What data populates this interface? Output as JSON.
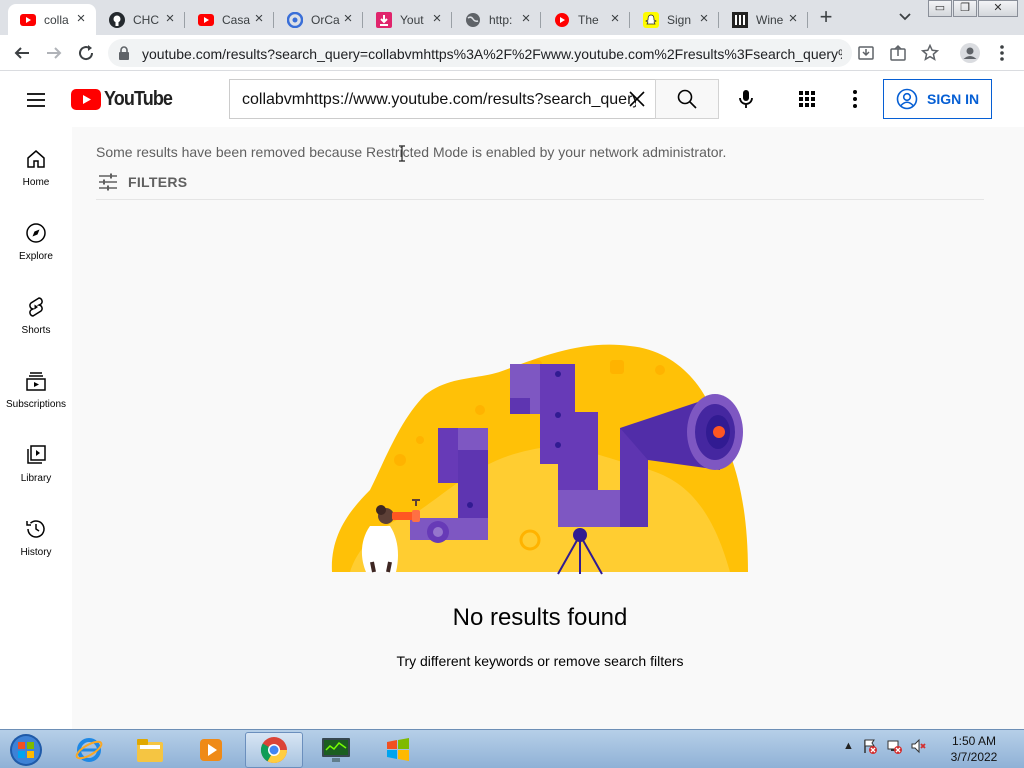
{
  "browser": {
    "tabs": [
      {
        "title": "colla",
        "icon": "youtube-icon",
        "active": true
      },
      {
        "title": "CHC",
        "icon": "github-icon",
        "active": false
      },
      {
        "title": "Casa",
        "icon": "youtube-icon",
        "active": false
      },
      {
        "title": "OrCa",
        "icon": "orca-icon",
        "active": false
      },
      {
        "title": "Yout",
        "icon": "download-icon",
        "active": false
      },
      {
        "title": "http:",
        "icon": "globe-icon",
        "active": false
      },
      {
        "title": "The",
        "icon": "youtube-icon",
        "active": false
      },
      {
        "title": "Sign",
        "icon": "snapchat-icon",
        "active": false
      },
      {
        "title": "Wine",
        "icon": "wine-icon",
        "active": false
      }
    ],
    "url": "youtube.com/results?search_query=collabvmhttps%3A%2F%2Fwww.youtube.com%2Fresults%3Fsearch_query%..."
  },
  "youtube": {
    "logo_text": "YouTube",
    "search_query": "collabvmhttps://www.youtube.com/results?search_query",
    "sign_in_label": "SIGN IN",
    "guide": [
      {
        "label": "Home",
        "icon": "home-icon"
      },
      {
        "label": "Explore",
        "icon": "explore-icon"
      },
      {
        "label": "Shorts",
        "icon": "shorts-icon"
      },
      {
        "label": "Subscriptions",
        "icon": "subscriptions-icon"
      },
      {
        "label": "Library",
        "icon": "library-icon"
      },
      {
        "label": "History",
        "icon": "history-icon"
      }
    ],
    "restricted_notice": "Some results have been removed because Restricted Mode is enabled by your network administrator.",
    "filters_label": "FILTERS",
    "no_results_title": "No results found",
    "no_results_hint": "Try different keywords or remove search filters"
  },
  "taskbar": {
    "time": "1:50 AM",
    "date": "3/7/2022"
  },
  "colors": {
    "youtube_red": "#ff0000",
    "link_blue": "#065fd4",
    "illustration_yellow": "#ffc107",
    "illustration_purple": "#6f3ad7"
  }
}
